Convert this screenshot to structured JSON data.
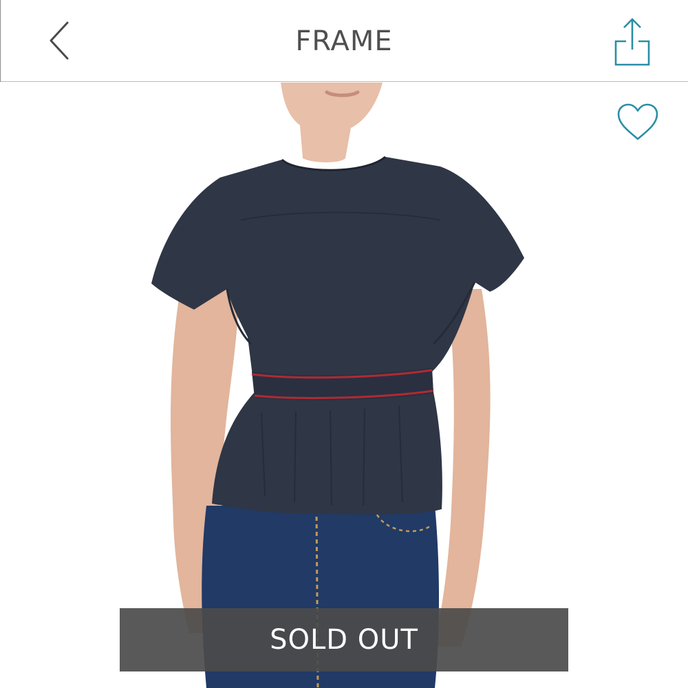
{
  "header": {
    "title": "FRAME",
    "back_icon": "chevron-left-icon",
    "share_icon": "share-icon"
  },
  "product": {
    "favorite_icon": "heart-outline-icon",
    "status_label": "SOLD OUT"
  },
  "colors": {
    "accent": "#2a8ea6",
    "title_text": "#4f4f4f",
    "banner_bg": "#4b4b4b",
    "garment": "#2f3645",
    "piping": "#b02a33",
    "denim": "#213a66"
  }
}
